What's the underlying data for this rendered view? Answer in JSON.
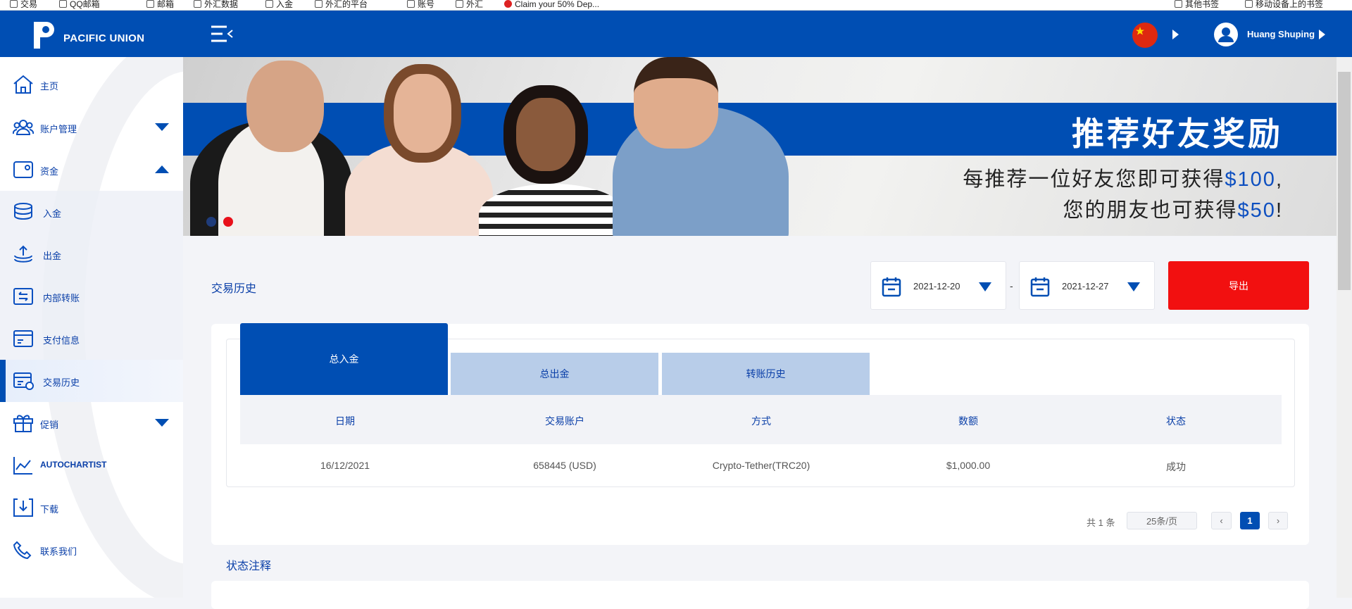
{
  "bookmarks": {
    "left": [
      "交易",
      "QQ邮箱",
      "邮箱",
      "外汇数据",
      "入金",
      "外汇的平台",
      "账号",
      "外汇",
      "Claim your 50% Dep..."
    ],
    "right": [
      "其他书签",
      "移动设备上的书签"
    ]
  },
  "header": {
    "brand": "PACIFIC UNION",
    "user_name": "Huang Shuping",
    "language_flag": "china-flag"
  },
  "sidebar": {
    "items": [
      {
        "label": "主页",
        "icon": "home-icon"
      },
      {
        "label": "账户管理",
        "icon": "users-icon",
        "caret": "down"
      },
      {
        "label": "资金",
        "icon": "wallet-icon",
        "caret": "up"
      },
      {
        "label": "入金",
        "icon": "coins-icon"
      },
      {
        "label": "出金",
        "icon": "upload-icon"
      },
      {
        "label": "内部转账",
        "icon": "transfer-icon"
      },
      {
        "label": "支付信息",
        "icon": "card-icon"
      },
      {
        "label": "交易历史",
        "icon": "history-icon",
        "active": true
      },
      {
        "label": "促销",
        "icon": "gift-icon",
        "caret": "down"
      },
      {
        "label": "AUTOCHARTIST",
        "icon": "chart-icon"
      },
      {
        "label": "下载",
        "icon": "download-icon"
      },
      {
        "label": "联系我们",
        "icon": "phone-icon"
      }
    ]
  },
  "banner": {
    "title": "推荐好友奖励",
    "line1_prefix": "每推荐一位好友您即可获得",
    "line1_amount": "$100",
    "line1_suffix": ",",
    "line2_prefix": "您的朋友也可获得",
    "line2_amount": "$50",
    "line2_suffix": "!",
    "slide_count": 2,
    "active_slide": 2
  },
  "page": {
    "title": "交易历史",
    "date_from": "2021-12-20",
    "date_sep": "-",
    "date_to": "2021-12-27",
    "export_label": "导出"
  },
  "tabs": [
    "总入金",
    "总出金",
    "转账历史"
  ],
  "table": {
    "headers": [
      "日期",
      "交易账户",
      "方式",
      "数额",
      "状态"
    ],
    "rows": [
      [
        "16/12/2021",
        "658445 (USD)",
        "Crypto-Tether(TRC20)",
        "$1,000.00",
        "成功"
      ]
    ]
  },
  "pagination": {
    "total": "共 1 条",
    "page_size": "25条/页",
    "prev": "‹",
    "current": "1",
    "next": "›"
  },
  "status_notes": {
    "title": "状态注释"
  },
  "colors": {
    "brand": "#004eb3",
    "export": "#f21010",
    "tab_inactive": "#b8cde9"
  }
}
